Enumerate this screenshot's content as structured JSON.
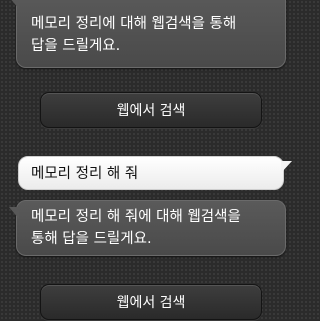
{
  "conversation": {
    "messages": [
      {
        "role": "system",
        "text_line1": "메모리 정리에 대해 웹검색을 통해",
        "text_line2": "답을 드릴게요."
      },
      {
        "role": "button",
        "label": "웹에서 검색"
      },
      {
        "role": "user",
        "text": "메모리 정리 해 줘"
      },
      {
        "role": "system",
        "text_line1": "메모리 정리 해 줘에 대해 웹검색을",
        "text_line2": "통해 답을 드릴게요."
      },
      {
        "role": "button",
        "label": "웹에서 검색"
      }
    ]
  }
}
